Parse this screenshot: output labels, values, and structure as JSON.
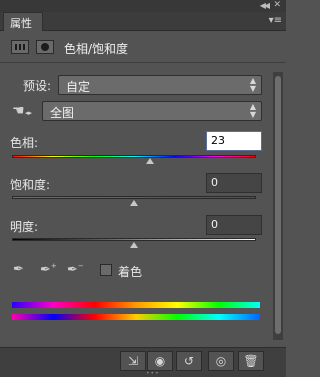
{
  "panel": {
    "tab_label": "属性",
    "title": "色相/饱和度",
    "collapse_icon": "double-chevron-left",
    "close_icon": "close-x",
    "menu_icon": "panel-menu"
  },
  "preset": {
    "label": "预设:",
    "value": "自定"
  },
  "range": {
    "value": "全图"
  },
  "hue": {
    "label": "色相:",
    "value": "23",
    "position": 0.5639
  },
  "saturation": {
    "label": "饱和度:",
    "value": "0",
    "position": 0.5
  },
  "lightness": {
    "label": "明度:",
    "value": "0",
    "position": 0.5
  },
  "colorize": {
    "label": "着色",
    "checked": false
  },
  "toolbar": {
    "icons": [
      "clip-to-layer-icon",
      "view-previous-state-icon",
      "reset-icon",
      "visibility-icon",
      "delete-icon"
    ]
  }
}
